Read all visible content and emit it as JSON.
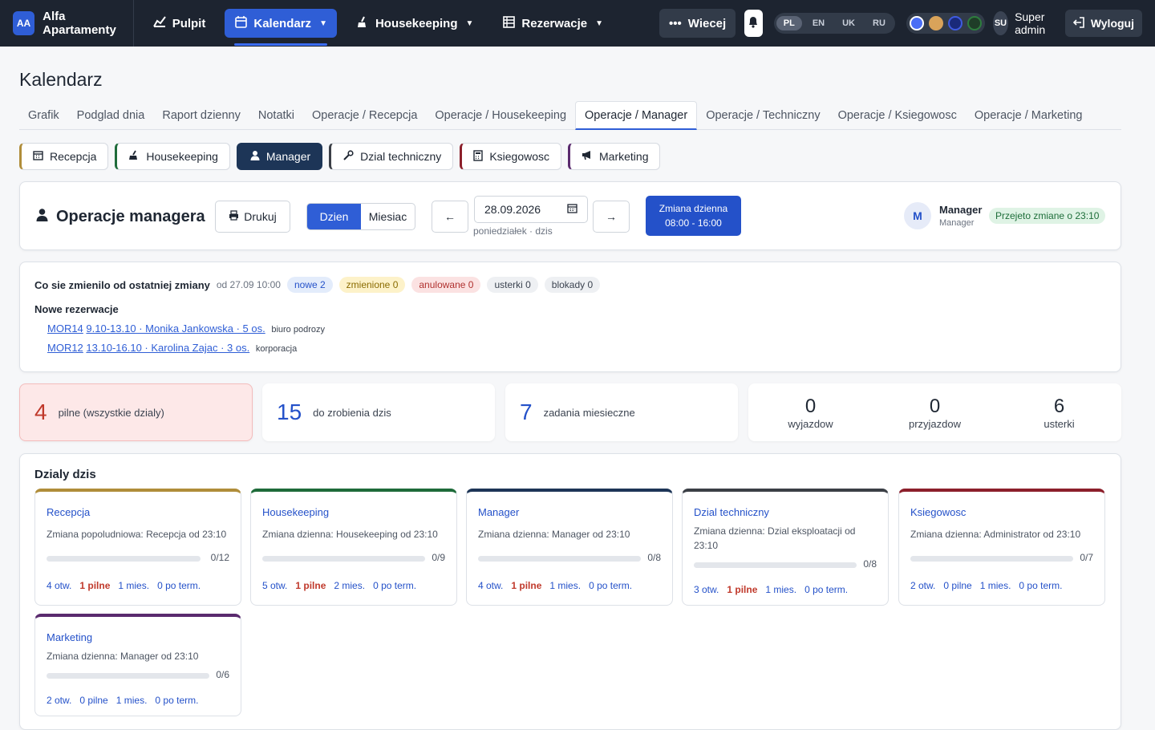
{
  "nav": {
    "brand_badge": "AA",
    "brand_name": "Alfa Apartamenty",
    "items": [
      {
        "label": "Pulpit",
        "icon": "chart-icon"
      },
      {
        "label": "Kalendarz",
        "icon": "calendar-icon",
        "active": true
      },
      {
        "label": "Housekeeping",
        "icon": "broom-icon"
      },
      {
        "label": "Rezerwacje",
        "icon": "list-icon"
      }
    ],
    "more_label": "Wiecej",
    "languages": [
      "PL",
      "EN",
      "UK",
      "RU"
    ],
    "active_language": "PL",
    "theme_colors": [
      "#4b6ef5",
      "#d9a35a",
      "#2a3fb5",
      "#2e7d3e"
    ],
    "user_initials": "SU",
    "user_name": "Super admin",
    "logout_label": "Wyloguj"
  },
  "page_title": "Kalendarz",
  "tabs": [
    "Grafik",
    "Podglad dnia",
    "Raport dzienny",
    "Notatki",
    "Operacje / Recepcja",
    "Operacje / Housekeeping",
    "Operacje / Manager",
    "Operacje / Techniczny",
    "Operacje / Ksiegowosc",
    "Operacje / Marketing"
  ],
  "active_tab": "Operacje / Manager",
  "dept_buttons": [
    {
      "label": "Recepcja",
      "color": "#b08d3a"
    },
    {
      "label": "Housekeeping",
      "color": "#1e6b3a"
    },
    {
      "label": "Manager",
      "color": "#1d3557",
      "active": true
    },
    {
      "label": "Dzial techniczny",
      "color": "#3b3f46"
    },
    {
      "label": "Ksiegowosc",
      "color": "#8c1f2b"
    },
    {
      "label": "Marketing",
      "color": "#5a2a6e"
    }
  ],
  "header": {
    "title": "Operacje managera",
    "print_label": "Drukuj",
    "view_day": "Dzien",
    "view_month": "Miesiac",
    "prev": "←",
    "next": "→",
    "date": "28.09.2026",
    "date_sub": "poniedziałek · dzis",
    "shift_title": "Zmiana dzienna",
    "shift_hours": "08:00 - 16:00",
    "manager_initial": "M",
    "manager_name": "Manager",
    "manager_role": "Manager",
    "taken_badge": "Przejeto zmiane o 23:10"
  },
  "changes": {
    "title": "Co sie zmienilo od ostatniej zmiany",
    "since": "od 27.09 10:00",
    "pills": {
      "new": "nowe 2",
      "changed": "zmienione 0",
      "cancelled": "anulowane 0",
      "faults": "usterki 0",
      "blocks": "blokady 0"
    },
    "new_title": "Nowe rezerwacje",
    "reservations": [
      {
        "code": "MOR14",
        "link": "9.10-13.10 · Monika Jankowska · 5 os.",
        "tag": "biuro podrozy"
      },
      {
        "code": "MOR12",
        "link": "13.10-16.10 · Karolina Zajac · 3 os.",
        "tag": "korporacja"
      }
    ]
  },
  "stats": {
    "urgent_num": "4",
    "urgent_label": "pilne (wszystkie dzialy)",
    "todo_num": "15",
    "todo_label": "do zrobienia dzis",
    "monthly_num": "7",
    "monthly_label": "zadania miesieczne",
    "departures_num": "0",
    "departures_label": "wyjazdow",
    "arrivals_num": "0",
    "arrivals_label": "przyjazdow",
    "faults_num": "6",
    "faults_label": "usterki"
  },
  "today": {
    "title": "Dzialy dzis",
    "cards": [
      {
        "name": "Recepcja",
        "shift": "Zmiana popoludniowa: Recepcja od 23:10",
        "ratio": "0/12",
        "open": "4 otw.",
        "urgent": "1 pilne",
        "monthly": "1 mies.",
        "overdue": "0 po term.",
        "color": "#b08d3a",
        "urgent_red": true
      },
      {
        "name": "Housekeeping",
        "shift": "Zmiana dzienna: Housekeeping od 23:10",
        "ratio": "0/9",
        "open": "5 otw.",
        "urgent": "1 pilne",
        "monthly": "2 mies.",
        "overdue": "0 po term.",
        "color": "#1e6b3a",
        "urgent_red": true
      },
      {
        "name": "Manager",
        "shift": "Zmiana dzienna: Manager od 23:10",
        "ratio": "0/8",
        "open": "4 otw.",
        "urgent": "1 pilne",
        "monthly": "1 mies.",
        "overdue": "0 po term.",
        "color": "#1d3557",
        "urgent_red": true
      },
      {
        "name": "Dzial techniczny",
        "shift": "Zmiana dzienna: Dzial eksploatacji od 23:10",
        "ratio": "0/8",
        "open": "3 otw.",
        "urgent": "1 pilne",
        "monthly": "1 mies.",
        "overdue": "0 po term.",
        "color": "#3b3f46",
        "urgent_red": true
      },
      {
        "name": "Ksiegowosc",
        "shift": "Zmiana dzienna: Administrator od 23:10",
        "ratio": "0/7",
        "open": "2 otw.",
        "urgent": "0 pilne",
        "monthly": "1 mies.",
        "overdue": "0 po term.",
        "color": "#8c1f2b",
        "urgent_red": false
      },
      {
        "name": "Marketing",
        "shift": "Zmiana dzienna: Manager od 23:10",
        "ratio": "0/6",
        "open": "2 otw.",
        "urgent": "0 pilne",
        "monthly": "1 mies.",
        "overdue": "0 po term.",
        "color": "#5a2a6e",
        "urgent_red": false
      }
    ]
  }
}
